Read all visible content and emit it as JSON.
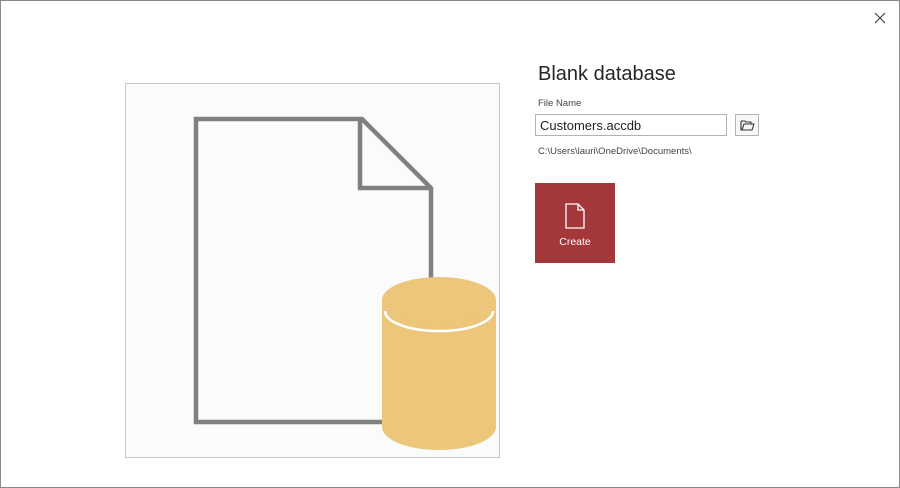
{
  "dialog": {
    "close_icon": "close-icon",
    "title": "Blank database",
    "file_name_label": "File Name",
    "file_name_value": "Customers.accdb",
    "browse_icon": "folder-open-icon",
    "save_path": "C:\\Users\\lauri\\OneDrive\\Documents\\",
    "create_label": "Create",
    "create_icon": "document-icon"
  },
  "colors": {
    "create_button": "#a4373a",
    "database_cylinder": "#ebc67b",
    "document_outline": "#808080"
  }
}
